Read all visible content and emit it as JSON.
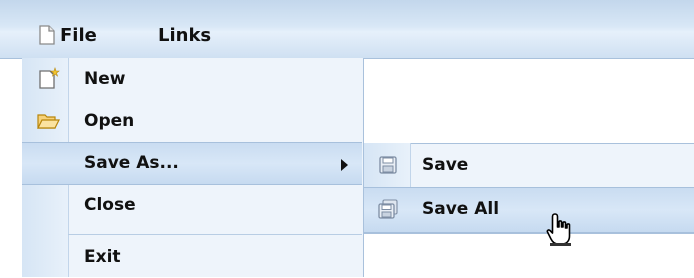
{
  "menubar": {
    "items": [
      {
        "label": "File",
        "icon": "file-icon"
      },
      {
        "label": "Links"
      }
    ]
  },
  "file_menu": {
    "items": [
      {
        "label": "New",
        "icon": "new-file-icon"
      },
      {
        "label": "Open",
        "icon": "open-folder-icon"
      },
      {
        "label": "Save As...",
        "has_submenu": true
      },
      {
        "label": "Close"
      },
      {
        "label": "Exit"
      }
    ]
  },
  "save_as_submenu": {
    "items": [
      {
        "label": "Save",
        "icon": "save-icon"
      },
      {
        "label": "Save All",
        "icon": "save-all-icon"
      }
    ]
  },
  "colors": {
    "menubar": "#d8e7f6",
    "menu_bg": "#eef4fb",
    "highlight": "#d0e2f5",
    "border": "#a9c1dc"
  }
}
